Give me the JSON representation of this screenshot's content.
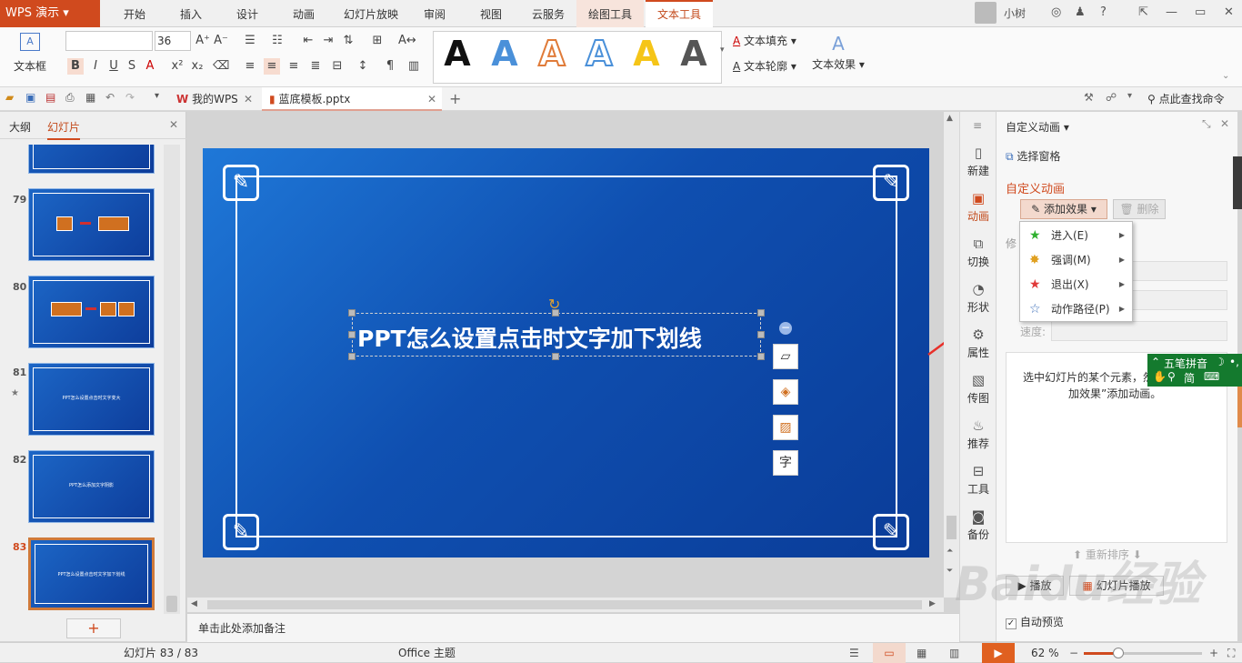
{
  "menubar": {
    "app_name": "WPS 演示",
    "tabs": [
      "开始",
      "插入",
      "设计",
      "动画",
      "幻灯片放映",
      "审阅",
      "视图",
      "云服务",
      "绘图工具",
      "文本工具"
    ],
    "user": "小树"
  },
  "ribbon": {
    "textbox_label": "文本框",
    "font_size": "36",
    "text_fill": "文本填充",
    "text_outline": "文本轮廓",
    "text_effect": "文本效果",
    "style_letters": [
      "A",
      "A",
      "A",
      "A",
      "A",
      "A"
    ],
    "style_colors": [
      "#111111",
      "#4a90d9",
      "#e07b39",
      "#4a90d9",
      "#f5c518",
      "#555555"
    ]
  },
  "quickbar": {
    "tabs": [
      "我的WPS",
      "蓝底模板.pptx"
    ],
    "search": "点此查找命令"
  },
  "leftpanel": {
    "tab_outline": "大纲",
    "tab_slides": "幻灯片",
    "slides": [
      {
        "num": "79",
        "text": ""
      },
      {
        "num": "80",
        "text": ""
      },
      {
        "num": "81",
        "text": "PPT怎么设置点击时文字变大"
      },
      {
        "num": "82",
        "text": "PPT怎么添加文字阴影"
      },
      {
        "num": "83",
        "text": "PPT怎么设置点击时文字加下划线"
      }
    ],
    "add_button": "+"
  },
  "slide": {
    "title": "PPT怎么设置点击时文字加下划线"
  },
  "notes_placeholder": "单击此处添加备注",
  "sidecol": [
    "新建",
    "动画",
    "切换",
    "形状",
    "属性",
    "传图",
    "推荐",
    "工具",
    "备份"
  ],
  "rightpanel": {
    "title": "自定义动画",
    "select_pane": "选择窗格",
    "section": "自定义动画",
    "add_effect": "添加效果",
    "delete": "删除",
    "modify_label": "修",
    "speed_label": "速度:",
    "hint_line1": "选中幻灯片的某个元素，然",
    "hint_line2": "加效果”添加动画。",
    "reorder": "重新排序",
    "play": "播放",
    "slideshow": "幻灯片播放",
    "autopreview": "自动预览"
  },
  "addmenu": {
    "items": [
      {
        "label": "进入(E)",
        "icon": "star-green-icon"
      },
      {
        "label": "强调(M)",
        "icon": "star-yellow-icon"
      },
      {
        "label": "退出(X)",
        "icon": "star-red-icon"
      },
      {
        "label": "动作路径(P)",
        "icon": "star-outline-icon"
      }
    ]
  },
  "ime": {
    "name": "五笔拼音",
    "mode": "简"
  },
  "statusbar": {
    "slide_count": "幻灯片 83 / 83",
    "theme": "Office 主题",
    "zoom": "62 %"
  },
  "watermark": "Baidu经验"
}
